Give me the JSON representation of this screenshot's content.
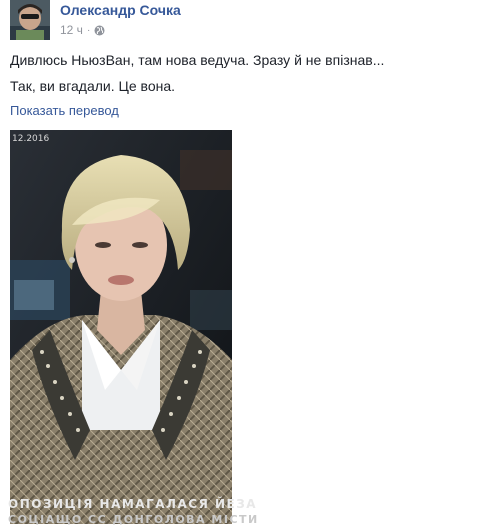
{
  "post": {
    "author": "Олександр Сочка",
    "time": "12 ч",
    "separator": "·",
    "privacy_icon": "globe-icon",
    "lines": [
      "Дивлюсь НьюзВан, там нова ведуча. Зразу й не впізнав...",
      "Так, ви вгадали. Це вона."
    ],
    "translate_link": "Показать перевод"
  },
  "photo": {
    "date_overlay": "12.2016",
    "caption_line1": "ОПОЗИЦІЯ НАМАГАЛАСЯ ЙЕЗА",
    "caption_line2": "СОЦІАЩО СС ДОНГОЛОВА МІСТИ"
  },
  "colors": {
    "link": "#365899",
    "meta": "#90949c",
    "text": "#1d2129"
  }
}
